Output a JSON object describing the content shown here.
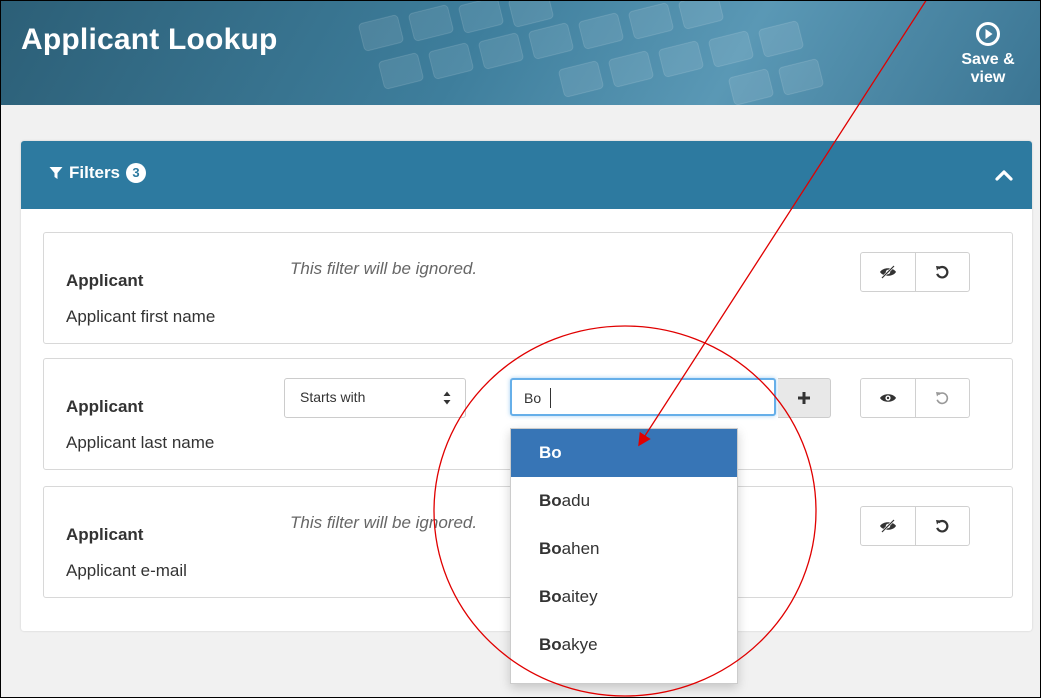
{
  "header": {
    "title": "Applicant Lookup",
    "save_view_label": "Save & view"
  },
  "filters": {
    "label": "Filters",
    "count": "3",
    "cards": [
      {
        "category": "Applicant",
        "field": "Applicant first name",
        "note": "This filter will be ignored.",
        "visibility_icon": "eye-slash-icon",
        "reset_icon": "undo-icon"
      },
      {
        "category": "Applicant",
        "field": "Applicant last name",
        "operator": "Starts with",
        "value": "Bo",
        "visibility_icon": "eye-icon",
        "reset_icon": "undo-icon"
      },
      {
        "category": "Applicant",
        "field": "Applicant e-mail",
        "note": "This filter will be ignored.",
        "visibility_icon": "eye-slash-icon",
        "reset_icon": "undo-icon"
      }
    ]
  },
  "autocomplete": {
    "items": [
      {
        "match": "Bo",
        "rest": ""
      },
      {
        "match": "Bo",
        "rest": "adu"
      },
      {
        "match": "Bo",
        "rest": "ahen"
      },
      {
        "match": "Bo",
        "rest": "aitey"
      },
      {
        "match": "Bo",
        "rest": "akye"
      }
    ],
    "active_index": 0
  },
  "colors": {
    "header": "#2c5f77",
    "panel_header": "#2d7aa0",
    "active_item": "#3775b6",
    "annotation": "#e00000"
  }
}
